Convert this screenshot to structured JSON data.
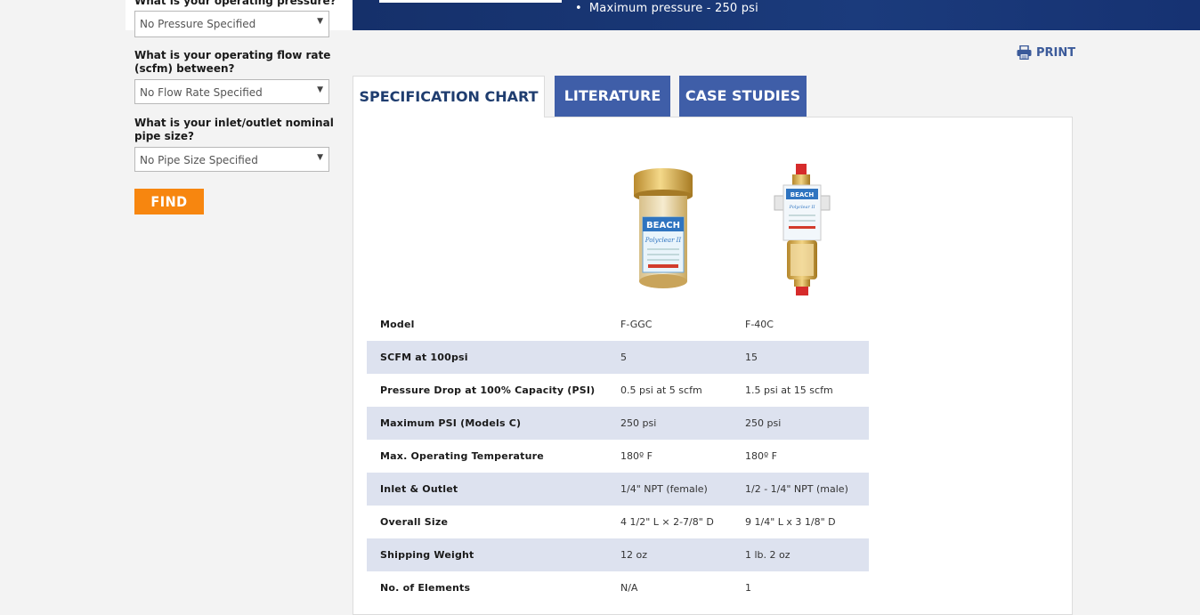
{
  "banner": {
    "bullet": "Maximum pressure - 250 psi"
  },
  "sidebar": {
    "q_pressure": "What is your operating pressure?",
    "select_pressure": "No Pressure Specified",
    "q_flow": "What is your operating flow rate (scfm) between?",
    "select_flow": "No Flow Rate Specified",
    "q_pipe": "What is your inlet/outlet nominal pipe size?",
    "select_pipe": "No Pipe Size Specified",
    "find_label": "FIND"
  },
  "print_label": "PRINT",
  "tabs": [
    {
      "label": "SPECIFICATION CHART"
    },
    {
      "label": "LITERATURE"
    },
    {
      "label": "CASE STUDIES"
    }
  ],
  "product_images": [
    {
      "brand": "BEACH",
      "product": "Polyclear II"
    },
    {
      "brand": "BEACH",
      "product": "Polyclear II"
    }
  ],
  "spec_table": [
    {
      "label": "Model",
      "a": "F-GGC",
      "b": "F-40C"
    },
    {
      "label": "SCFM at 100psi",
      "a": "5",
      "b": "15"
    },
    {
      "label": "Pressure Drop at 100% Capacity (PSI)",
      "a": "0.5 psi at 5 scfm",
      "b": "1.5 psi at 15 scfm"
    },
    {
      "label": "Maximum PSI (Models C)",
      "a": "250 psi",
      "b": "250 psi"
    },
    {
      "label": "Max. Operating Temperature",
      "a": "180º F",
      "b": "180º F"
    },
    {
      "label": "Inlet & Outlet",
      "a": "1/4\" NPT (female)",
      "b": "1/2 - 1/4\" NPT (male)"
    },
    {
      "label": "Overall Size",
      "a": "4 1/2\" L × 2-7/8\" D",
      "b": "9 1/4\" L x 3 1/8\" D"
    },
    {
      "label": "Shipping Weight",
      "a": "12 oz",
      "b": "1 lb. 2 oz"
    },
    {
      "label": "No. of Elements",
      "a": "N/A",
      "b": "1"
    }
  ],
  "colors": {
    "banner": "#1b3b7c",
    "tab_active_text": "#1f3d6f",
    "tab_inactive_bg": "#3f5ea8",
    "find_button": "#f7860f",
    "row_shade": "#dde2ef"
  }
}
